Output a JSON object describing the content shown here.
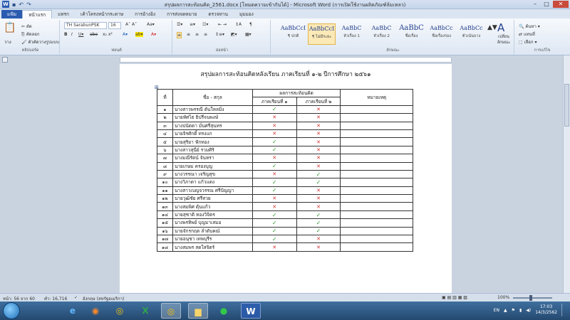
{
  "window": {
    "title": "สรุปผลการสะท้อนคิด_2561.docx [โหมดความเข้ากันได้] - Microsoft Word (การเปิดใช้งานผลิตภัณฑ์ล้มเหลว)",
    "word_icon": "W",
    "quick_access": [
      "save-icon",
      "undo-icon",
      "redo-icon"
    ]
  },
  "ribbon_tabs": [
    "แฟ้ม",
    "หน้าแรก",
    "แทรก",
    "เค้าโครงหน้ากระดาษ",
    "การอ้างอิง",
    "การส่งจดหมาย",
    "ตรวจทาน",
    "มุมมอง"
  ],
  "ribbon": {
    "clipboard": {
      "paste": "วาง",
      "cut": "ตัด",
      "copy": "คัดลอก",
      "format_painter": "ตัวคัดวางรูปแบบ",
      "label": "คลิปบอร์ด"
    },
    "font": {
      "name": "TH SarabunPSK",
      "size": "16",
      "label": "ฟอนต์"
    },
    "paragraph": {
      "label": "ย่อหน้า"
    },
    "styles": {
      "label": "ลักษณะ",
      "items": [
        {
          "sample": "AaBbCcI",
          "name": "¶ ปกติ"
        },
        {
          "sample": "AaBbCcI",
          "name": "¶ ไม่มีระยะ"
        },
        {
          "sample": "AaBbC",
          "name": "หัวเรื่อง 1"
        },
        {
          "sample": "AaBbC",
          "name": "หัวเรื่อง 2"
        },
        {
          "sample": "AaBbC",
          "name": "ชื่อเรื่อง"
        },
        {
          "sample": "AaBbCc",
          "name": "ชื่อเรื่องรอง"
        },
        {
          "sample": "AaBbCc",
          "name": "ตัวเน้นบาง"
        }
      ],
      "change_styles": "เปลี่ยนลักษณะ"
    },
    "editing": {
      "find": "ค้นหา",
      "replace": "แทนที่",
      "select": "เลือก",
      "label": "การแก้ไข"
    }
  },
  "document": {
    "heading": "สรุปผลการสะท้อนคิดหลังเรียน  ภาคเรียนที่ ๑-๒ ปีการศึกษา ๒๕๖๑",
    "table": {
      "header": {
        "no": "ที่",
        "name": "ชื่อ - สกุล",
        "group": "ผลการสะท้อนคิด",
        "term1": "ภาคเรียนที่ ๑",
        "term2": "ภาคเรียนที่ ๒",
        "note": "หมายเหตุ"
      },
      "rows": [
        {
          "no": "๑",
          "name": "นางสาวพรรณี ตันใหลมิ่ง",
          "t1": "check",
          "t2": "cross"
        },
        {
          "no": "๒",
          "name": "นายทัศไธ ธิปรีจนพงษ์",
          "t1": "cross",
          "t2": "cross"
        },
        {
          "no": "๓",
          "name": "นางปนัดดา มั่นศรีสุนทร",
          "t1": "cross",
          "t2": "cross"
        },
        {
          "no": "๔",
          "name": "นายจิรศักดิ์ ทรงแก",
          "t1": "cross",
          "t2": "cross"
        },
        {
          "no": "๕",
          "name": "นายสุริยา ฟักทอง",
          "t1": "check",
          "t2": "cross"
        },
        {
          "no": "๖",
          "name": "นางสาวสุนีย์ รวมศิริ",
          "t1": "check",
          "t2": "cross"
        },
        {
          "no": "๗",
          "name": "นางมณีรัตน์ จันทรา",
          "t1": "cross",
          "t2": "cross"
        },
        {
          "no": "๘",
          "name": "นายเกษม ครองบุญ",
          "t1": "check",
          "t2": "cross"
        },
        {
          "no": "๙",
          "name": "นางวรรณา เจริญสุข",
          "t1": "cross",
          "t2": "check"
        },
        {
          "no": "๑๐",
          "name": "นางวิภาดา แก้วแดง",
          "t1": "check",
          "t2": "check"
        },
        {
          "no": "๑๑",
          "name": "นางสาวเบญจวรรณ ศรีปัญญา",
          "t1": "check",
          "t2": "cross"
        },
        {
          "no": "๑๒",
          "name": "นายวุฒิชัย ศรีสวย",
          "t1": "cross",
          "t2": "cross"
        },
        {
          "no": "๑๓",
          "name": "นางสมพิศ ดุ้นแก้ว",
          "t1": "cross",
          "t2": "cross"
        },
        {
          "no": "๑๔",
          "name": "นายสุชาติ ทองวิจิตร",
          "t1": "check",
          "t2": "check"
        },
        {
          "no": "๑๕",
          "name": "นางพรทิพย์ บุญมาเสมอ",
          "t1": "check",
          "t2": "check"
        },
        {
          "no": "๑๖",
          "name": "นายจักรกฤต ลำดับคณ์",
          "t1": "check",
          "t2": "check"
        },
        {
          "no": "๑๗",
          "name": "นายอนุชา เทพบุรีร",
          "t1": "check",
          "t2": "cross"
        },
        {
          "no": "๑๘",
          "name": "นางสมพร สดใสจิตร์",
          "t1": "cross",
          "t2": "cross"
        }
      ]
    }
  },
  "status": {
    "page": "หน้า: 56 จาก 60",
    "words": "คำ: 16,716",
    "language": "อังกฤษ (สหรัฐอเมริกา)",
    "zoom": "100%"
  },
  "taskbar": {
    "apps": [
      "start-orb",
      "internet-explorer-icon",
      "firefox-icon",
      "chrome-icon",
      "excel-icon",
      "chrome-alt-icon",
      "folder-icon",
      "line-icon",
      "word-icon"
    ],
    "tray_language": "EN",
    "time": "17:03",
    "date": "14/3/2562"
  }
}
